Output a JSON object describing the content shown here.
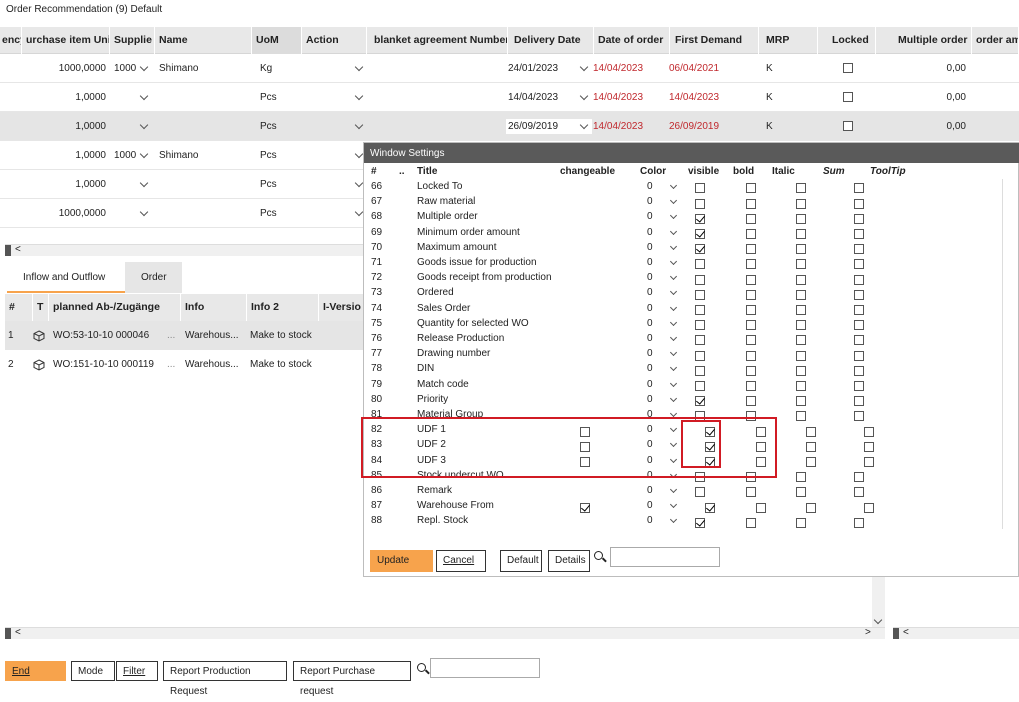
{
  "window": {
    "title": "Order Recommendation (9) Default"
  },
  "main_grid": {
    "columns": [
      "ency",
      "urchase item Unit",
      "Supplie",
      "Name",
      "UoM",
      "Action",
      "blanket agreement Number",
      "Delivery Date",
      "Date of order",
      "First Demand",
      "MRP",
      "Locked",
      "Multiple order",
      "order am"
    ],
    "rows": [
      {
        "qty": "1000,0000",
        "supplier": "1000",
        "name": "Shimano",
        "uom": "Kg",
        "delivery": "24/01/2023",
        "order_date": "14/04/2023",
        "first_demand": "06/04/2021",
        "mrp": "K",
        "multiple": "0,00"
      },
      {
        "qty": "1,0000",
        "supplier": "",
        "name": "",
        "uom": "Pcs",
        "delivery": "14/04/2023",
        "order_date": "14/04/2023",
        "first_demand": "14/04/2023",
        "mrp": "K",
        "multiple": "0,00"
      },
      {
        "qty": "1,0000",
        "supplier": "",
        "name": "",
        "uom": "Pcs",
        "delivery": "26/09/2019",
        "order_date": "14/04/2023",
        "first_demand": "26/09/2019",
        "mrp": "K",
        "multiple": "0,00"
      },
      {
        "qty": "1,0000",
        "supplier": "1000",
        "name": "Shimano",
        "uom": "Pcs"
      },
      {
        "qty": "1,0000",
        "supplier": "",
        "name": "",
        "uom": "Pcs"
      },
      {
        "qty": "1000,0000",
        "supplier": "",
        "name": "",
        "uom": "Pcs"
      }
    ]
  },
  "lower_tabs": [
    "Inflow and Outflow",
    "Order"
  ],
  "lower_grid": {
    "columns": [
      "#",
      "T",
      "planned Ab-/Zugänge",
      "Info",
      "Info 2",
      "I-Versio"
    ],
    "rows": [
      {
        "num": "1",
        "planned": "WO:53-10-10 000046",
        "dots": "...",
        "info": "Warehous...",
        "info2": "Make to stock"
      },
      {
        "num": "2",
        "planned": "WO:151-10-10 000119",
        "dots": "...",
        "info": "Warehous...",
        "info2": "Make to stock"
      }
    ]
  },
  "settings": {
    "title": "Window Settings",
    "columns": [
      "#",
      "..",
      "Title",
      "changeable",
      "Color",
      "visible",
      "bold",
      "Italic",
      "Sum",
      "ToolTip"
    ],
    "rows": [
      {
        "n": "66",
        "title": "Locked To",
        "color": "0",
        "visible": false,
        "changeable": false
      },
      {
        "n": "67",
        "title": "Raw material",
        "color": "0",
        "visible": false,
        "changeable": false
      },
      {
        "n": "68",
        "title": "Multiple order",
        "color": "0",
        "visible": true,
        "changeable": false
      },
      {
        "n": "69",
        "title": "Minimum order amount",
        "color": "0",
        "visible": true,
        "changeable": false
      },
      {
        "n": "70",
        "title": "Maximum amount",
        "color": "0",
        "visible": true,
        "changeable": false
      },
      {
        "n": "71",
        "title": "Goods issue for production",
        "color": "0",
        "visible": false,
        "changeable": false
      },
      {
        "n": "72",
        "title": "Goods receipt from production",
        "color": "0",
        "visible": false,
        "changeable": false
      },
      {
        "n": "73",
        "title": "Ordered",
        "color": "0",
        "visible": false,
        "changeable": false
      },
      {
        "n": "74",
        "title": "Sales Order",
        "color": "0",
        "visible": false,
        "changeable": false
      },
      {
        "n": "75",
        "title": "Quantity for selected WO",
        "color": "0",
        "visible": false,
        "changeable": false
      },
      {
        "n": "76",
        "title": "Release Production",
        "color": "0",
        "visible": false,
        "changeable": false
      },
      {
        "n": "77",
        "title": "Drawing number",
        "color": "0",
        "visible": false,
        "changeable": false
      },
      {
        "n": "78",
        "title": "DIN",
        "color": "0",
        "visible": false,
        "changeable": false
      },
      {
        "n": "79",
        "title": "Match code",
        "color": "0",
        "visible": false,
        "changeable": false
      },
      {
        "n": "80",
        "title": "Priority",
        "color": "0",
        "visible": true,
        "changeable": false
      },
      {
        "n": "81",
        "title": "Material Group",
        "color": "0",
        "visible": false,
        "changeable": false
      },
      {
        "n": "82",
        "title": "UDF 1",
        "color": "0",
        "visible": true,
        "changeable": "empty"
      },
      {
        "n": "83",
        "title": "UDF 2",
        "color": "0",
        "visible": true,
        "changeable": "empty"
      },
      {
        "n": "84",
        "title": "UDF 3",
        "color": "0",
        "visible": true,
        "changeable": "empty"
      },
      {
        "n": "85",
        "title": "Stock undercut WO",
        "color": "0",
        "visible": false,
        "changeable": false
      },
      {
        "n": "86",
        "title": "Remark",
        "color": "0",
        "visible": false,
        "changeable": false
      },
      {
        "n": "87",
        "title": "Warehouse From",
        "color": "0",
        "visible": true,
        "changeable": true
      },
      {
        "n": "88",
        "title": "Repl. Stock",
        "color": "0",
        "visible": true,
        "changeable": false
      }
    ],
    "buttons": {
      "update": "Update",
      "cancel": "Cancel",
      "default": "Default",
      "details": "Details"
    }
  },
  "bottom_toolbar": {
    "end": "End",
    "mode": "Mode",
    "filter": "Filter",
    "report_production": "Report Production Request",
    "report_purchase": "Report Purchase request"
  },
  "scroll_left": "<",
  "scroll_right": ">"
}
